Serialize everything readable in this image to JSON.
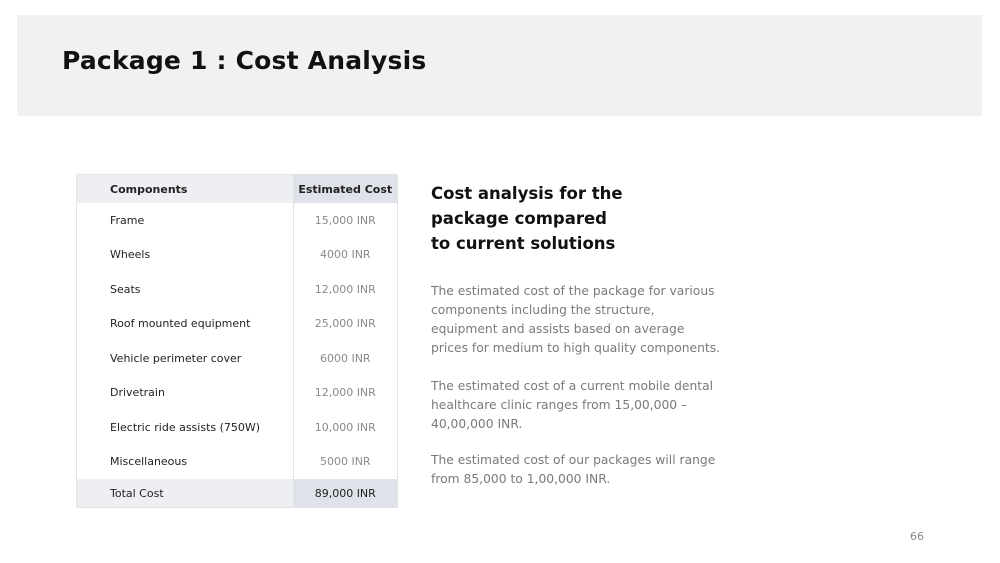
{
  "header": {
    "title": "Package 1 : Cost Analysis"
  },
  "table": {
    "headers": [
      "Components",
      "Estimated Cost"
    ],
    "rows": [
      {
        "component": "Frame",
        "cost": "15,000 INR"
      },
      {
        "component": "Wheels",
        "cost": "4000 INR"
      },
      {
        "component": "Seats",
        "cost": "12,000 INR"
      },
      {
        "component": "Roof mounted equipment",
        "cost": "25,000 INR"
      },
      {
        "component": "Vehicle perimeter cover",
        "cost": "6000 INR"
      },
      {
        "component": "Drivetrain",
        "cost": "12,000 INR"
      },
      {
        "component": "Electric ride assists (750W)",
        "cost": "10,000 INR"
      },
      {
        "component": "Miscellaneous",
        "cost": "5000 INR"
      }
    ],
    "total": {
      "label": "Total Cost",
      "cost": "89,000 INR"
    }
  },
  "content": {
    "heading_lines": [
      "Cost analysis for the",
      "package compared",
      "to current solutions"
    ],
    "paragraphs": [
      "The estimated cost of the package for various components including the structure, equipment and assists based on average prices for medium to high quality components.",
      "The estimated cost of a current mobile dental healthcare clinic ranges from 15,00,000 – 40,00,000 INR.",
      "The estimated cost of our packages will range from 85,000 to 1,00,000 INR."
    ]
  },
  "footer": {
    "page_number": "66"
  }
}
